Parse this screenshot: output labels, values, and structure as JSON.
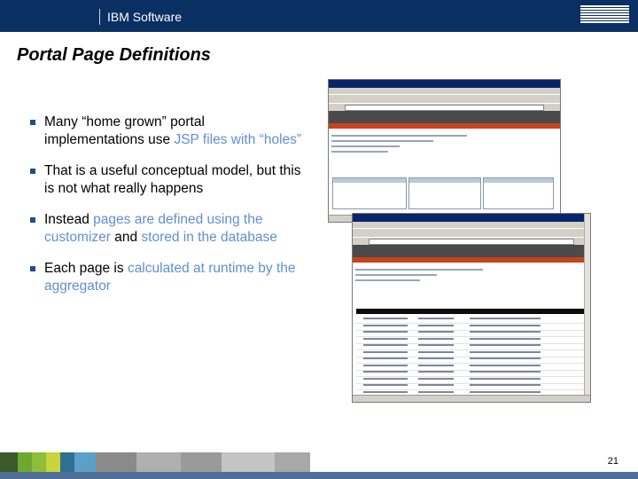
{
  "header": {
    "brand": "IBM Software",
    "logo_text": "IBM"
  },
  "title": "Portal Page Definitions",
  "bullets": [
    {
      "parts": [
        {
          "text": "Many “home grown” portal implementations use ",
          "hl": false
        },
        {
          "text": "JSP files with “holes”",
          "hl": true
        }
      ]
    },
    {
      "parts": [
        {
          "text": "That is a useful conceptual model, but this is not what really happens",
          "hl": false
        }
      ]
    },
    {
      "parts": [
        {
          "text": "Instead ",
          "hl": false
        },
        {
          "text": "pages are defined using the customizer",
          "hl": true
        },
        {
          "text": " and ",
          "hl": false
        },
        {
          "text": "stored in the database",
          "hl": true
        }
      ]
    },
    {
      "parts": [
        {
          "text": "Each page is ",
          "hl": false
        },
        {
          "text": "calculated at runtime by the aggregator",
          "hl": true
        }
      ]
    }
  ],
  "page_number": "21",
  "colors": {
    "header_bg": "#0a2f63",
    "highlight": "#5f8fd3",
    "bullet_mark": "#1f4e8c"
  }
}
